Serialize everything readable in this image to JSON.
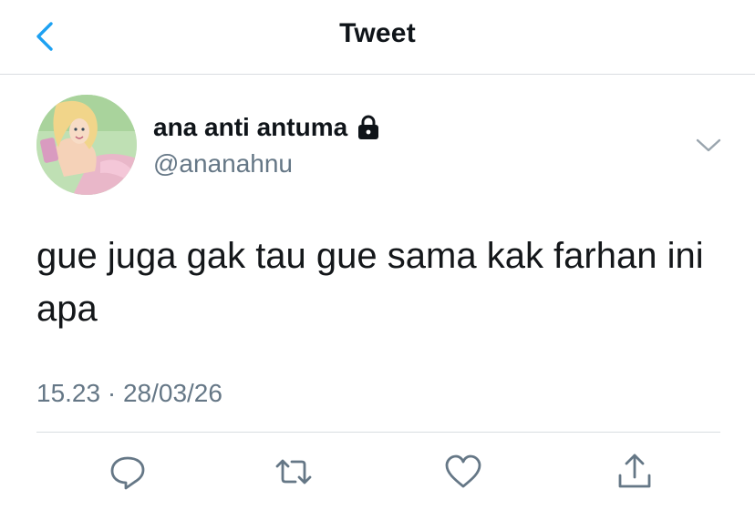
{
  "header": {
    "title": "Tweet",
    "back_icon": "chevron-left-icon"
  },
  "colors": {
    "accent": "#1da1f2",
    "text": "#0f1419",
    "secondary": "#657786",
    "divider": "#d9dde1"
  },
  "tweet": {
    "author": {
      "display_name": "ana anti antuma",
      "handle": "@ananahnu",
      "protected_icon": "lock-icon"
    },
    "text": "gue juga gak tau gue sama kak farhan ini apa",
    "timestamp": "15.23 · 28/03/26",
    "more_icon": "chevron-down-icon"
  },
  "actions": [
    {
      "name": "reply",
      "icon": "reply-icon"
    },
    {
      "name": "retweet",
      "icon": "retweet-icon"
    },
    {
      "name": "like",
      "icon": "heart-icon"
    },
    {
      "name": "share",
      "icon": "share-icon"
    }
  ]
}
